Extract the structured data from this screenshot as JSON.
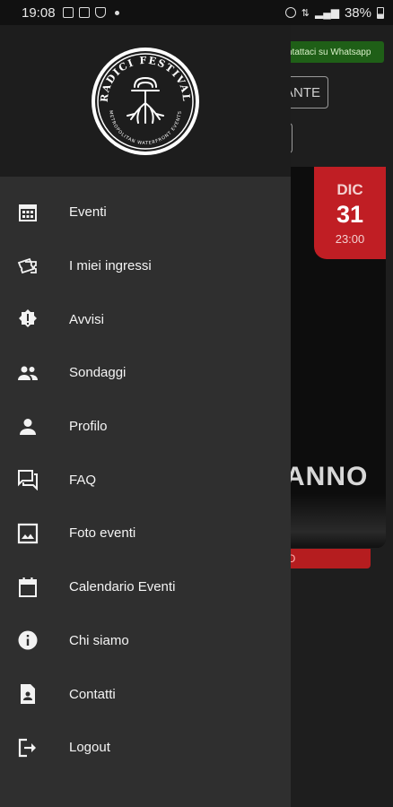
{
  "status_bar": {
    "time": "19:08",
    "battery": "38%"
  },
  "background": {
    "whatsapp_button": "ntattaci su Whatsapp",
    "outline_button": "ANTE",
    "date_badge": {
      "month": "DIC",
      "day": "31",
      "time": "23:00"
    },
    "card_title_fragment": "ANNO",
    "red_bar_label": "O"
  },
  "drawer": {
    "logo": {
      "top_text": "RADICI FESTIVAL",
      "bottom_text": "METROPOLITAN WATERFRONT EVENTS"
    },
    "items": [
      {
        "label": "Eventi",
        "icon": "calendar-grid-icon"
      },
      {
        "label": "I miei ingressi",
        "icon": "tickets-icon"
      },
      {
        "label": "Avvisi",
        "icon": "alert-badge-icon"
      },
      {
        "label": "Sondaggi",
        "icon": "people-icon"
      },
      {
        "label": "Profilo",
        "icon": "person-icon"
      },
      {
        "label": "FAQ",
        "icon": "forum-icon"
      },
      {
        "label": "Foto eventi",
        "icon": "image-icon"
      },
      {
        "label": "Calendario Eventi",
        "icon": "calendar-icon"
      },
      {
        "label": "Chi siamo",
        "icon": "info-icon"
      },
      {
        "label": "Contatti",
        "icon": "contact-icon"
      },
      {
        "label": "Logout",
        "icon": "logout-icon"
      }
    ]
  },
  "colors": {
    "drawer_bg": "#2f2f2f",
    "header_bg": "#1d1d1d",
    "accent_red": "#c01e24",
    "whatsapp_green": "#1f5f17"
  }
}
